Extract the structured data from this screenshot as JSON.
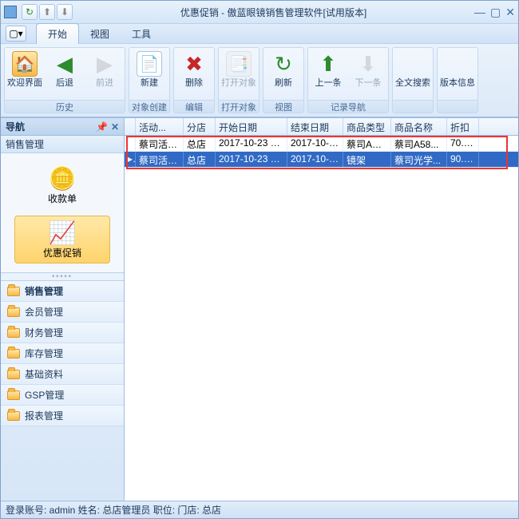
{
  "window": {
    "title": "优惠促销 - 傲蓝眼镜销售管理软件[试用版本]"
  },
  "tabs": {
    "start": "开始",
    "view": "视图",
    "tools": "工具"
  },
  "ribbon": {
    "groups": {
      "history": {
        "label": "历史",
        "welcome": "欢迎界面",
        "back": "后退",
        "forward": "前进"
      },
      "create": {
        "label": "对象创建",
        "new": "新建"
      },
      "edit": {
        "label": "编辑",
        "delete": "删除"
      },
      "open": {
        "label": "打开对象",
        "open": "打开对象"
      },
      "viewg": {
        "label": "视图",
        "refresh": "刷新"
      },
      "nav": {
        "label": "记录导航",
        "prev": "上一条",
        "next": "下一条"
      },
      "search": {
        "label": "全文搜索"
      },
      "version": {
        "label": "版本信息"
      }
    }
  },
  "nav": {
    "title": "导航",
    "section": "销售管理",
    "shortcuts": {
      "receipt": "收款单",
      "promo": "优惠促销"
    },
    "items": [
      "销售管理",
      "会员管理",
      "财务管理",
      "库存管理",
      "基础资料",
      "GSP管理",
      "报表管理"
    ]
  },
  "grid": {
    "columns": [
      "活动...",
      "分店",
      "开始日期",
      "结束日期",
      "商品类型",
      "商品名称",
      "折扣"
    ],
    "rows": [
      {
        "activity": "蔡司活动日",
        "store": "总店",
        "start": "2017-10-23 0...",
        "end": "2017-10-2...",
        "ptype": "蔡司A系列",
        "pname": "蔡司A58...",
        "disc": "70.0..."
      },
      {
        "activity": "蔡司活动日",
        "store": "总店",
        "start": "2017-10-23 0...",
        "end": "2017-10-2...",
        "ptype": "镜架",
        "pname": "蔡司光学...",
        "disc": "90.0..."
      }
    ]
  },
  "status": {
    "text": "登录账号: admin  姓名: 总店管理员  职位:   门店: 总店"
  }
}
